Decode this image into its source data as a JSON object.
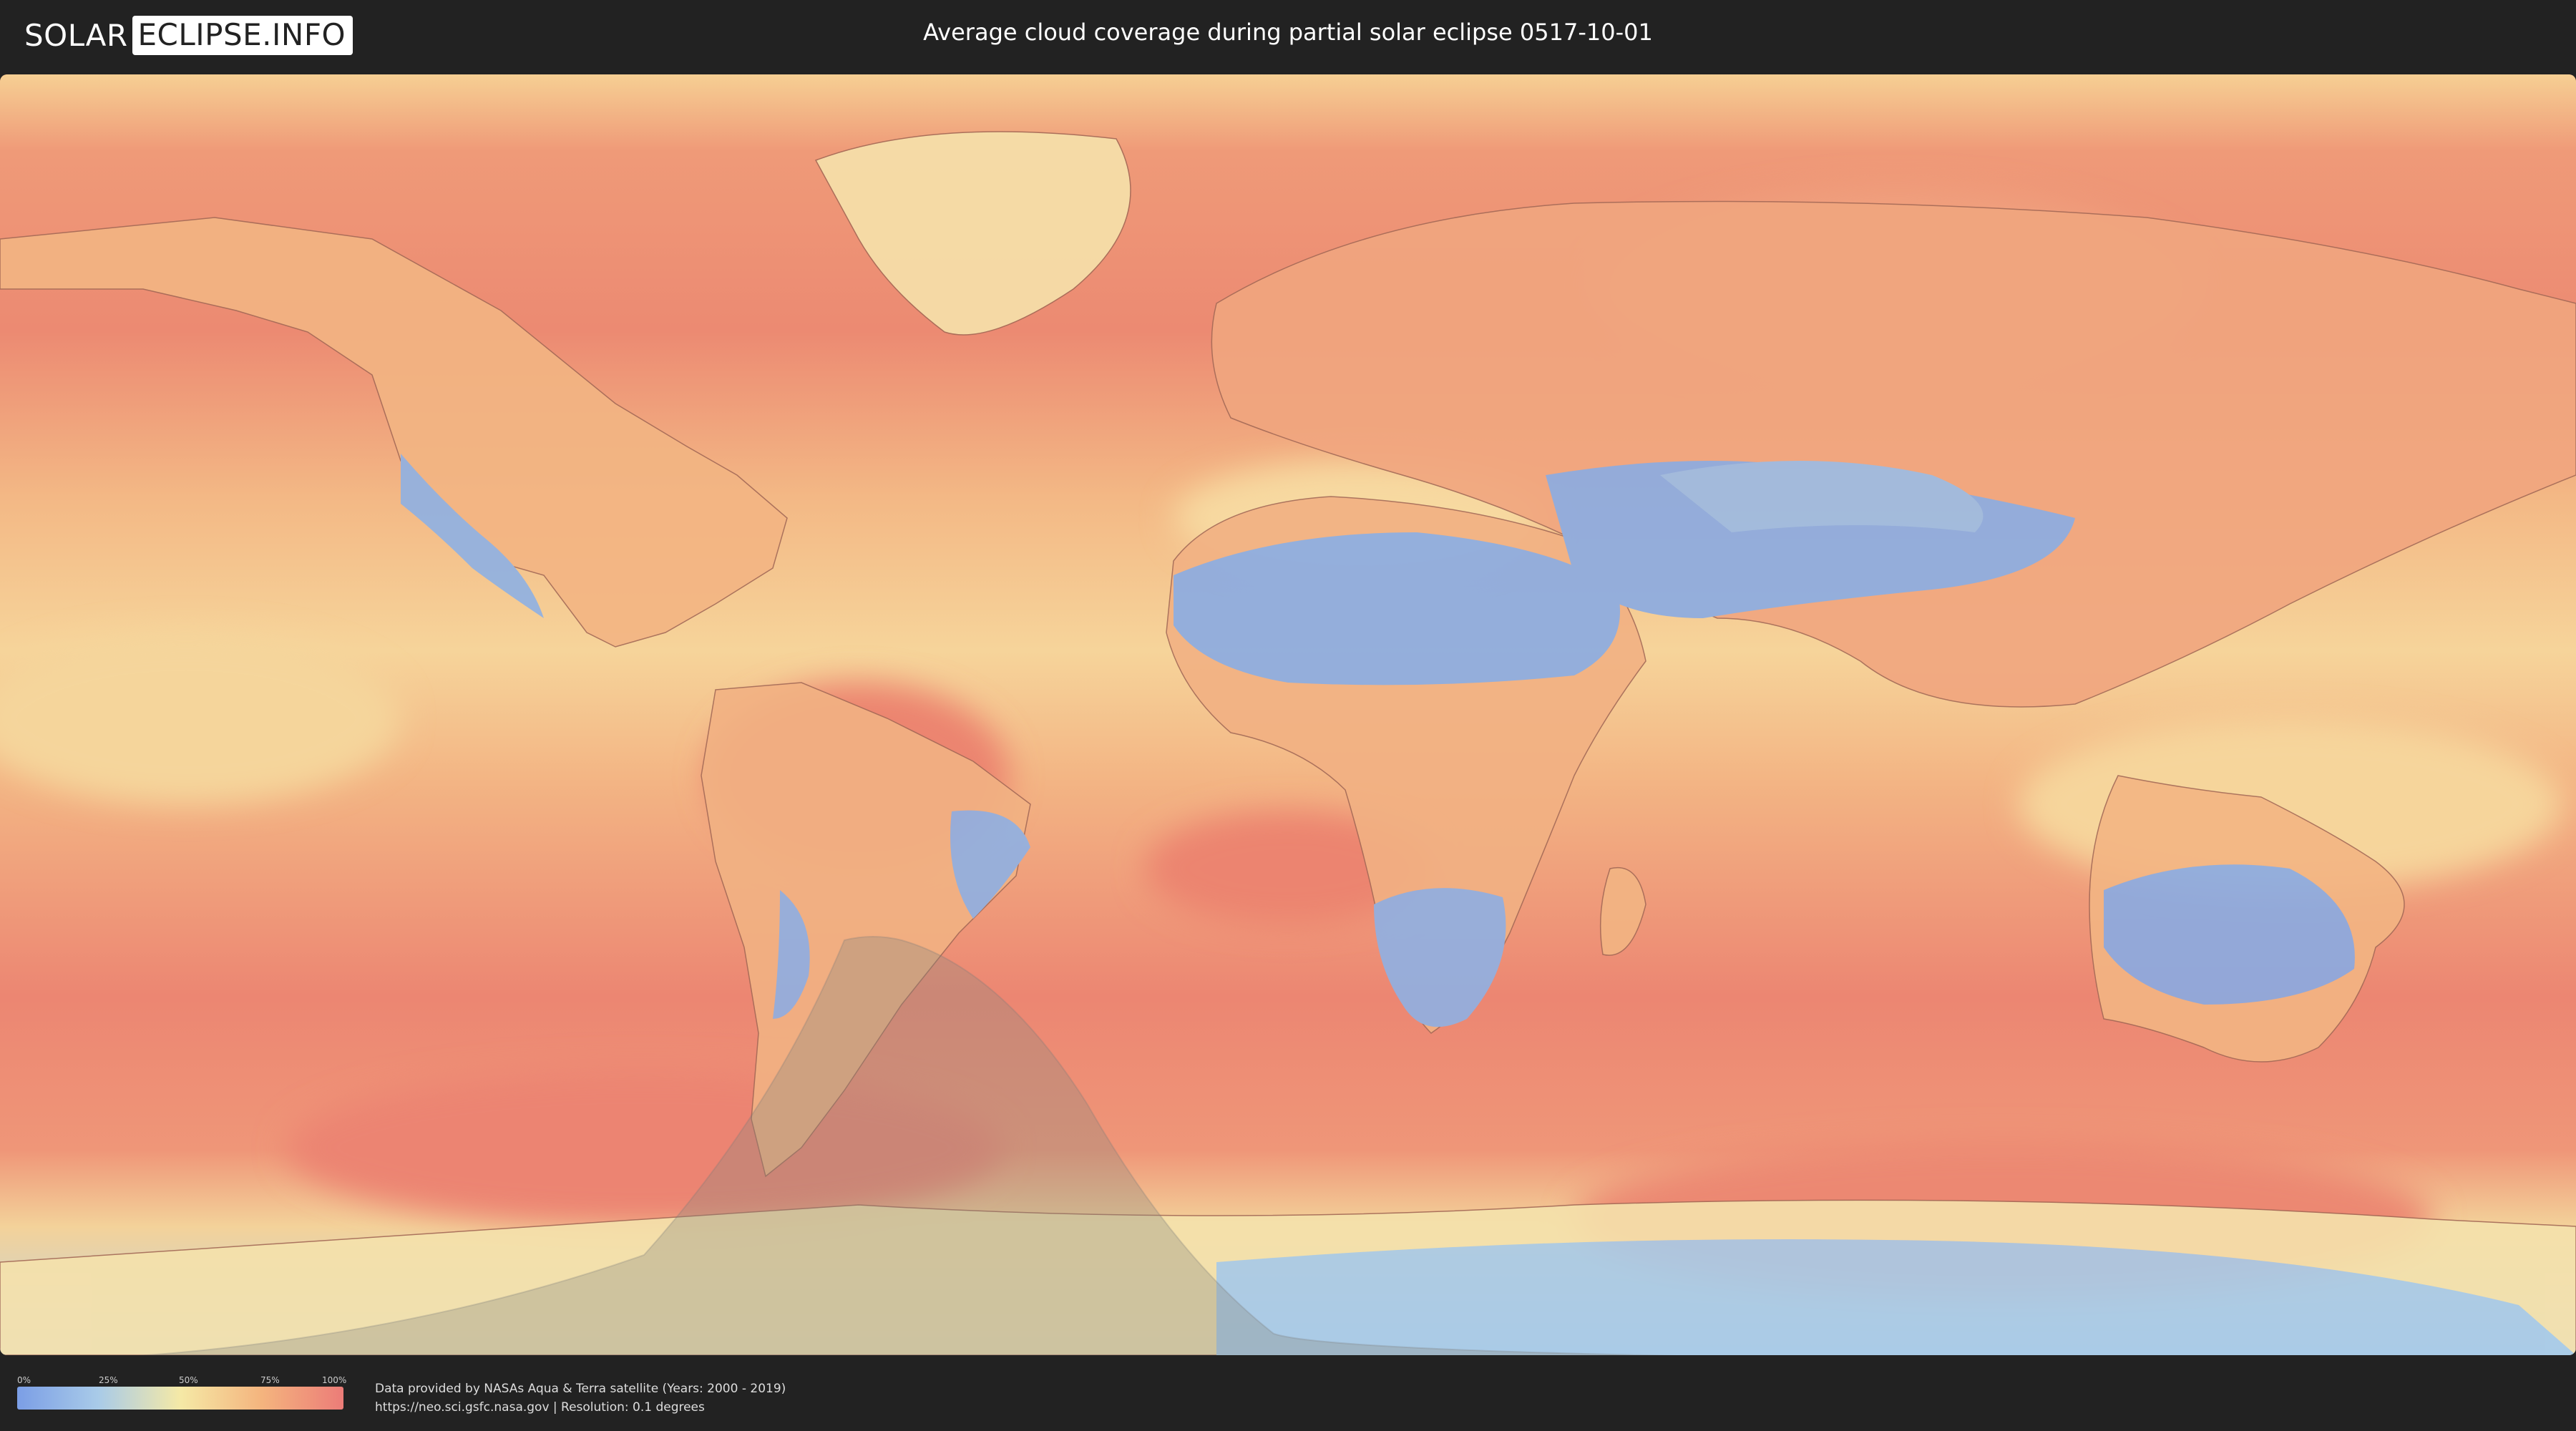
{
  "header": {
    "logo_left": "SOLAR",
    "logo_right": "ECLIPSE.INFO",
    "title": "Average cloud coverage during partial solar eclipse 0517-10-01"
  },
  "legend": {
    "ticks": [
      "0%",
      "25%",
      "50%",
      "75%",
      "100%"
    ],
    "colors": [
      "#7b9ee6",
      "#a9cbe8",
      "#f5e9a6",
      "#f4b47e",
      "#ec7c78"
    ]
  },
  "footer": {
    "line1": "Data provided by NASAs Aqua & Terra satellite (Years: 2000 - 2019)",
    "line2": "https://neo.sci.gsfc.nasa.gov | Resolution: 0.1 degrees"
  },
  "map": {
    "eclipse_shadow_color": "#8a8a80"
  }
}
